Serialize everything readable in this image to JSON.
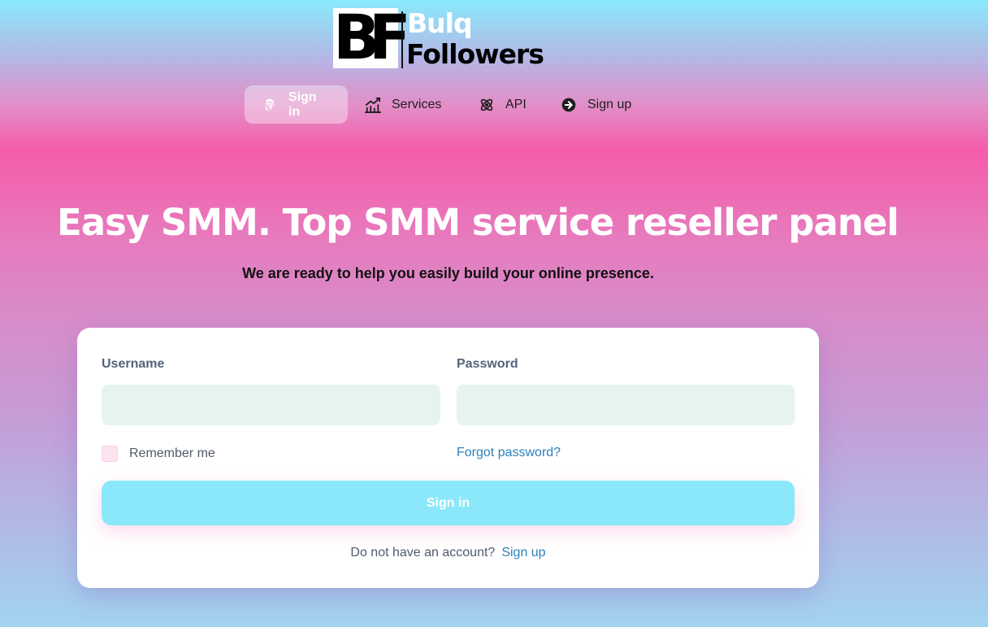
{
  "brand": {
    "mark": "BF",
    "word1": "Bulq",
    "word2": "Followers"
  },
  "nav": {
    "items": [
      {
        "label": "Sign in",
        "icon": "fingerprint-icon"
      },
      {
        "label": "Services",
        "icon": "chart-icon"
      },
      {
        "label": "API",
        "icon": "atom-icon"
      },
      {
        "label": "Sign up",
        "icon": "arrow-circle-right-icon"
      }
    ]
  },
  "hero": {
    "title": "Easy SMM. Top SMM service reseller panel",
    "subtitle": "We are ready to help you easily build your online presence."
  },
  "form": {
    "username_label": "Username",
    "username_value": "",
    "password_label": "Password",
    "password_value": "",
    "remember_label": "Remember me",
    "remember_checked": false,
    "forgot_label": "Forgot password?",
    "submit_label": "Sign in",
    "no_account_text": "Do not have an account?",
    "signup_link": "Sign up"
  },
  "colors": {
    "accent": "#8ae8fa",
    "link": "#2d7fb8",
    "input_bg": "#e6f4f1",
    "pink": "#f55ca9"
  }
}
